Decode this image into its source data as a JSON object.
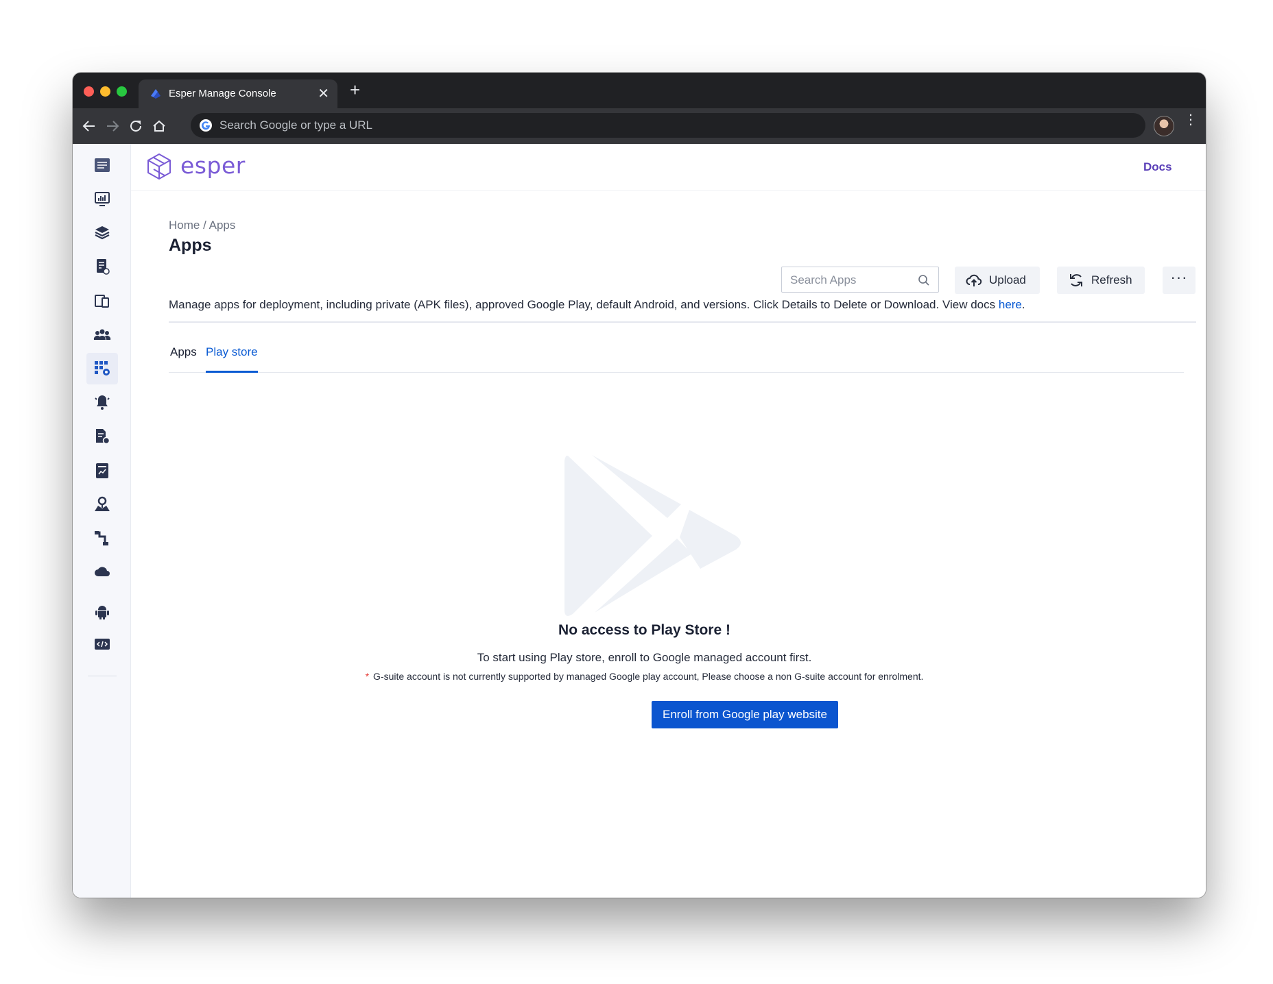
{
  "browser": {
    "tab_title": "Esper Manage Console",
    "tab_close": "✕",
    "new_tab": "+",
    "omnibox_placeholder": "Search Google or type a URL",
    "kebab": "⋮"
  },
  "header": {
    "logo_text": "esper",
    "docs_label": "Docs"
  },
  "sidebar": {
    "items": [
      {
        "name": "menu-icon"
      },
      {
        "name": "dashboard-icon"
      },
      {
        "name": "blueprints-icon"
      },
      {
        "name": "provisioning-icon"
      },
      {
        "name": "devices-icon"
      },
      {
        "name": "groups-icon"
      },
      {
        "name": "apps-icon",
        "active": true
      },
      {
        "name": "alerts-icon"
      },
      {
        "name": "content-icon"
      },
      {
        "name": "reports-icon"
      },
      {
        "name": "geofence-icon"
      },
      {
        "name": "pipelines-icon"
      },
      {
        "name": "cloud-icon"
      },
      {
        "name": "android-icon"
      },
      {
        "name": "developer-icon"
      }
    ]
  },
  "breadcrumb": {
    "home": "Home",
    "current": "/ Apps"
  },
  "page": {
    "title": "Apps",
    "search_placeholder": "Search Apps",
    "upload_label": "Upload",
    "refresh_label": "Refresh",
    "more_label": "···",
    "description": "Manage apps for deployment, including private (APK files), approved Google Play, default Android, and versions. Click Details to Delete or Download. View docs ",
    "docs_here": "here",
    "description_end": "."
  },
  "tabs": [
    {
      "label": "Apps",
      "active": false
    },
    {
      "label": "Play store",
      "active": true
    }
  ],
  "empty_state": {
    "title": "No access to Play Store !",
    "description": "To start using Play store, enroll to Google managed account first.",
    "note_star": "*",
    "note": "G-suite account is not currently supported by managed Google play account, Please choose a non G-suite account for enrolment.",
    "button_label": "Enroll from Google play website"
  },
  "colors": {
    "primary": "#0b55cf",
    "brand": "#7a5bd6",
    "sidebar_bg": "#f6f7fb"
  }
}
